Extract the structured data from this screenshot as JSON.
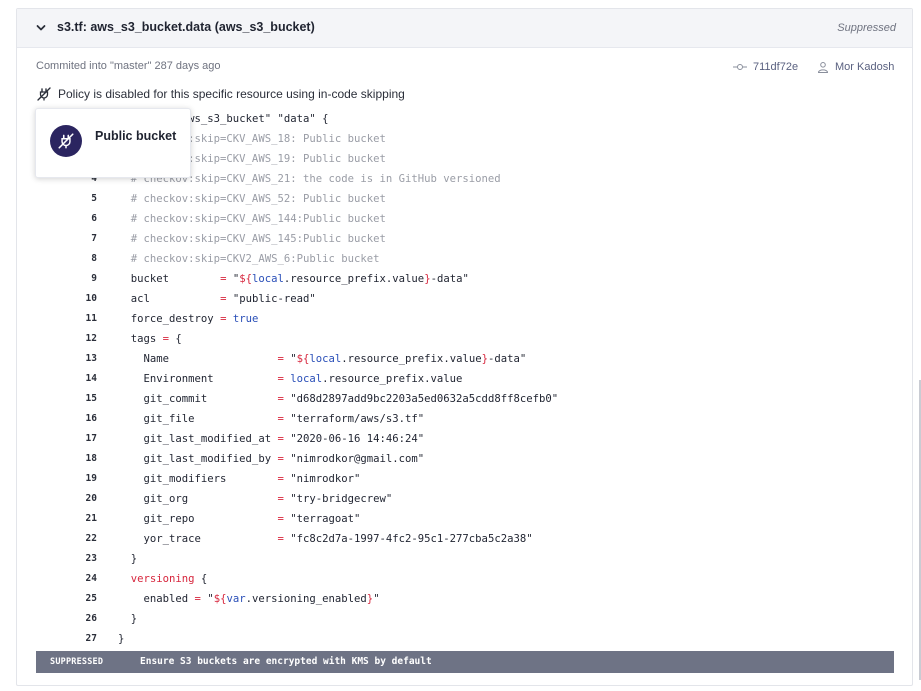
{
  "header": {
    "title": "s3.tf: aws_s3_bucket.data (aws_s3_bucket)",
    "status": "Suppressed"
  },
  "meta": {
    "commit_text": "Commited into \"master\" 287 days ago",
    "hash": "711df72e",
    "author": "Mor Kadosh",
    "icons": {
      "hash": "commit-icon",
      "author": "user-icon",
      "chevron": "chevron-down-icon",
      "policy": "plug-off-icon"
    }
  },
  "policy_note": "Policy is disabled for this specific resource using in-code skipping",
  "popup": {
    "label": "Public bucket",
    "icon": "plug-off-icon"
  },
  "code_lines": [
    {
      "n": "1",
      "t": "resource \"aws_s3_bucket\" \"data\" {"
    },
    {
      "n": "2",
      "t": "  # checkov:skip=CKV_AWS_18: Public bucket"
    },
    {
      "n": "3",
      "t": "  # checkov:skip=CKV_AWS_19: Public bucket"
    },
    {
      "n": "4",
      "t": "  # checkov:skip=CKV_AWS_21: the code is in GitHub versioned"
    },
    {
      "n": "5",
      "t": "  # checkov:skip=CKV_AWS_52: Public bucket"
    },
    {
      "n": "6",
      "t": "  # checkov:skip=CKV_AWS_144:Public bucket"
    },
    {
      "n": "7",
      "t": "  # checkov:skip=CKV_AWS_145:Public bucket"
    },
    {
      "n": "8",
      "t": "  # checkov:skip=CKV2_AWS_6:Public bucket"
    },
    {
      "n": "9",
      "t": "  bucket        = \"${local.resource_prefix.value}-data\""
    },
    {
      "n": "10",
      "t": "  acl           = \"public-read\""
    },
    {
      "n": "11",
      "t": "  force_destroy = true"
    },
    {
      "n": "12",
      "t": "  tags = {"
    },
    {
      "n": "13",
      "t": "    Name                 = \"${local.resource_prefix.value}-data\""
    },
    {
      "n": "14",
      "t": "    Environment          = local.resource_prefix.value"
    },
    {
      "n": "15",
      "t": "    git_commit           = \"d68d2897add9bc2203a5ed0632a5cdd8ff8cefb0\""
    },
    {
      "n": "16",
      "t": "    git_file             = \"terraform/aws/s3.tf\""
    },
    {
      "n": "17",
      "t": "    git_last_modified_at = \"2020-06-16 14:46:24\""
    },
    {
      "n": "18",
      "t": "    git_last_modified_by = \"nimrodkor@gmail.com\""
    },
    {
      "n": "19",
      "t": "    git_modifiers        = \"nimrodkor\""
    },
    {
      "n": "20",
      "t": "    git_org              = \"try-bridgecrew\""
    },
    {
      "n": "21",
      "t": "    git_repo             = \"terragoat\""
    },
    {
      "n": "22",
      "t": "    yor_trace            = \"fc8c2d7a-1997-4fc2-95c1-277cba5c2a38\""
    },
    {
      "n": "23",
      "t": "  }"
    },
    {
      "n": "24",
      "t": "  versioning {"
    },
    {
      "n": "25",
      "t": "    enabled = \"${var.versioning_enabled}\""
    },
    {
      "n": "26",
      "t": "  }"
    },
    {
      "n": "27",
      "t": "}"
    }
  ],
  "footer": {
    "tag": "SUPPRESSED",
    "message": "Ensure S3 buckets are encrypted with KMS by default"
  },
  "colors": {
    "keyword": "#d7263d",
    "variable": "#2a4fb8",
    "comment": "#9a9da6",
    "popup_badge": "#2b2560",
    "footer_bg": "#6e7385"
  }
}
